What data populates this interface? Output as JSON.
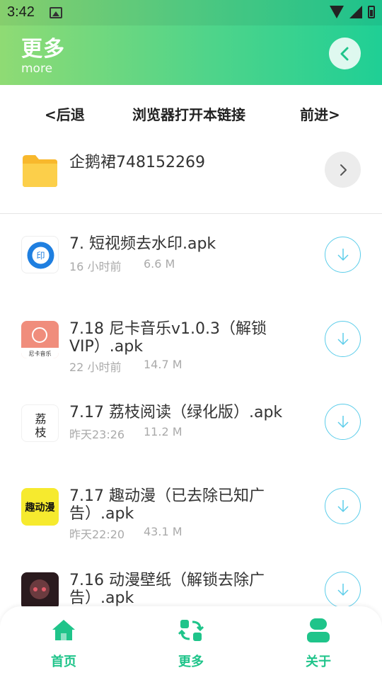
{
  "status_bar": {
    "time": "3:42"
  },
  "header": {
    "title": "更多",
    "subtitle": "more"
  },
  "nav": {
    "back": "<后退",
    "open_in_browser": "浏览器打开本链接",
    "forward": "前进>"
  },
  "folder": {
    "name": "企鹅裙748152269"
  },
  "files": [
    {
      "name": "7. 短视频去水印.apk",
      "time": "16 小时前",
      "size": "6.6 M",
      "icon": "watermark-app-icon"
    },
    {
      "name": "7.18 尼卡音乐v1.0.3（解锁VIP）.apk",
      "time": "22 小时前",
      "size": "14.7 M",
      "icon": "nika-music-icon",
      "icon_text": "尼卡音乐"
    },
    {
      "name": "7.17 荔枝阅读（绿化版）.apk",
      "time": "昨天23:26",
      "size": "11.2 M",
      "icon": "lizhi-reader-icon",
      "icon_text": "荔枝"
    },
    {
      "name": "7.17 趣动漫（已去除已知广告）.apk",
      "time": "昨天22:20",
      "size": "43.1 M",
      "icon": "qudongman-icon",
      "icon_text": "趣动漫"
    },
    {
      "name": "7.16 动漫壁纸（解锁去除广告）.apk",
      "time": "",
      "size": "",
      "icon": "anime-wallpaper-icon"
    }
  ],
  "tabs": {
    "home": "首页",
    "more": "更多",
    "about": "关于"
  },
  "colors": {
    "accent": "#1fc48a",
    "download_ring": "#5ccdea",
    "gradient_start": "#8fdb74",
    "gradient_end": "#1fcf95"
  }
}
